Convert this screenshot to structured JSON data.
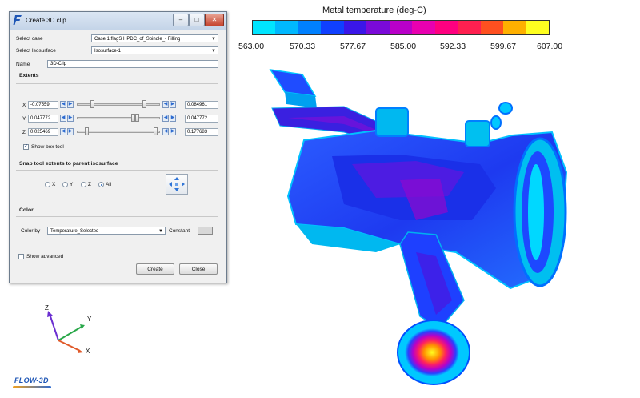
{
  "dialog": {
    "title": "Create 3D clip",
    "close_glyph": "✕",
    "select_case_label": "Select case",
    "select_case_value": "Case 1:flagS HPDC_of_Spindle_- Filling",
    "select_isosurface_label": "Select Isosurface",
    "select_isosurface_value": "Isosurface-1",
    "name_label": "Name",
    "name_value": "3D-Clip",
    "extents_title": "Extents",
    "extents": [
      {
        "axis": "X",
        "min": "-0.07559",
        "max": "0.084961"
      },
      {
        "axis": "Y",
        "min": "0.047772",
        "max": "0.047772"
      },
      {
        "axis": "Z",
        "min": "0.025469",
        "max": "0.177683"
      }
    ],
    "show_box_tool_label": "Show box tool",
    "show_box_tool_checked": true,
    "snap_title": "Snap tool extents to parent isosurface",
    "snap_options": [
      "X",
      "Y",
      "Z",
      "All"
    ],
    "snap_selected": "All",
    "color_title": "Color",
    "color_by_label": "Color by",
    "color_by_value": "Temperature_Selected",
    "constant_label": "Constant",
    "show_advanced_label": "Show advanced",
    "create_label": "Create",
    "close_label": "Close"
  },
  "colorbar": {
    "title": "Metal temperature (deg-C)",
    "ticks": [
      "563.00",
      "570.33",
      "577.67",
      "585.00",
      "592.33",
      "599.67",
      "607.00"
    ],
    "colors": [
      "#00e5ff",
      "#00b8ff",
      "#0080ff",
      "#1040ff",
      "#3a16e8",
      "#7a0ad8",
      "#b800c8",
      "#e800b0",
      "#ff0080",
      "#ff2050",
      "#ff5020",
      "#ffb000",
      "#ffff20"
    ]
  },
  "axes": {
    "z": "Z",
    "y": "Y",
    "x": "X"
  },
  "logo": "FLOW-3D"
}
